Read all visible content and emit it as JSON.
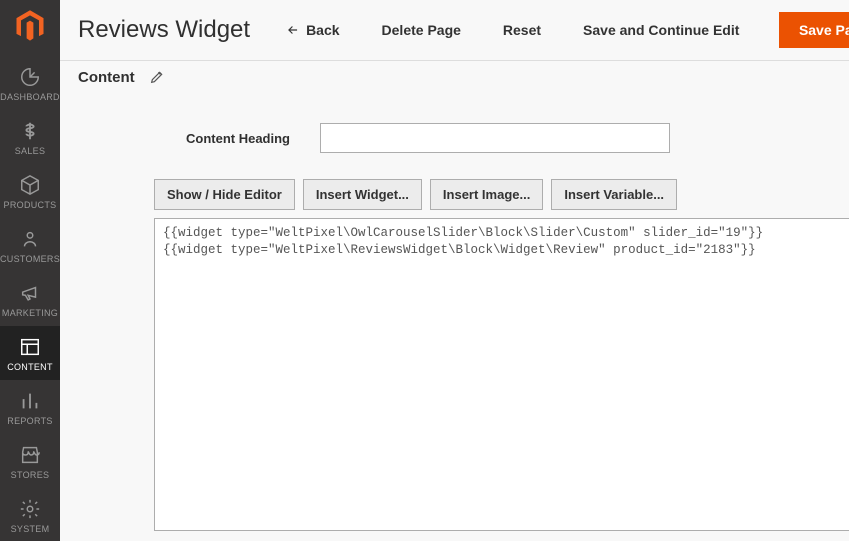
{
  "page_title": "Reviews Widget",
  "header": {
    "back": "Back",
    "delete": "Delete Page",
    "reset": "Reset",
    "save_continue": "Save and Continue Edit",
    "save": "Save Page"
  },
  "sidebar": {
    "items": [
      {
        "label": "DASHBOARD"
      },
      {
        "label": "SALES"
      },
      {
        "label": "PRODUCTS"
      },
      {
        "label": "CUSTOMERS"
      },
      {
        "label": "MARKETING"
      },
      {
        "label": "CONTENT"
      },
      {
        "label": "REPORTS"
      },
      {
        "label": "STORES"
      },
      {
        "label": "SYSTEM"
      }
    ]
  },
  "section": {
    "title": "Content"
  },
  "form": {
    "content_heading_label": "Content Heading",
    "content_heading_value": ""
  },
  "editor": {
    "toolbar": {
      "show_hide": "Show / Hide Editor",
      "insert_widget": "Insert Widget...",
      "insert_image": "Insert Image...",
      "insert_variable": "Insert Variable..."
    },
    "content": "{{widget type=\"WeltPixel\\OwlCarouselSlider\\Block\\Slider\\Custom\" slider_id=\"19\"}}\n{{widget type=\"WeltPixel\\ReviewsWidget\\Block\\Widget\\Review\" product_id=\"2183\"}}"
  }
}
